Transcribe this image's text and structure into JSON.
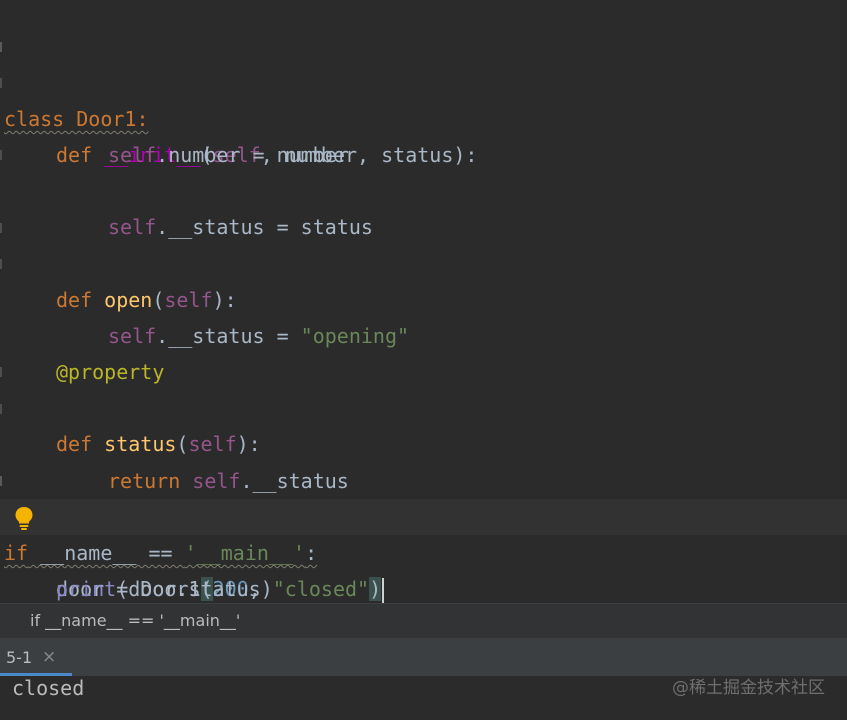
{
  "code": {
    "line_class": "class Door1:",
    "line_init": {
      "def": "def ",
      "name": "__init__",
      "open": "(",
      "self": "self",
      "rest": ", number, status):"
    },
    "line_self_number": {
      "self": "self",
      "rest": ".number = number"
    },
    "line_self_status": {
      "self": "self",
      "rest": ".__status = status"
    },
    "line_def_open": {
      "def": "def ",
      "name": "open",
      "open": "(",
      "self": "self",
      "close": "):"
    },
    "line_open_body": {
      "self": "self",
      "mid": ".__status = ",
      "str": "\"opening\""
    },
    "line_decorator": "@property",
    "line_def_status": {
      "def": "def ",
      "name": "status",
      "open": "(",
      "self": "self",
      "close": "):"
    },
    "line_return": {
      "ret": "return ",
      "self": "self",
      "rest": ".__status"
    },
    "line_if": {
      "if": "if",
      "mid": " __name__ == ",
      "str": "'__main__'",
      "colon": ":"
    },
    "line_door": {
      "pre": "door = Door1",
      "open": "(",
      "num": "200",
      "comma": ", ",
      "str": "\"closed\"",
      "close": ")"
    },
    "line_print": {
      "fn": "print",
      "rest": "(door.status)"
    }
  },
  "breadcrumb": "if __name__ == '__main__'",
  "run_tab": {
    "label": "5-1",
    "close": "×"
  },
  "console": {
    "output": "closed"
  },
  "watermark": "@稀土掘金技术社区",
  "colors": {
    "background": "#2b2b2b",
    "keyword": "#cc7832",
    "self": "#94558d",
    "string": "#6a8759",
    "number": "#6897bb",
    "decorator": "#bbb529",
    "function": "#ffc66d",
    "builtin": "#8888c6",
    "magic": "#b200b2"
  },
  "icons": {
    "intention": "lightbulb-icon"
  }
}
